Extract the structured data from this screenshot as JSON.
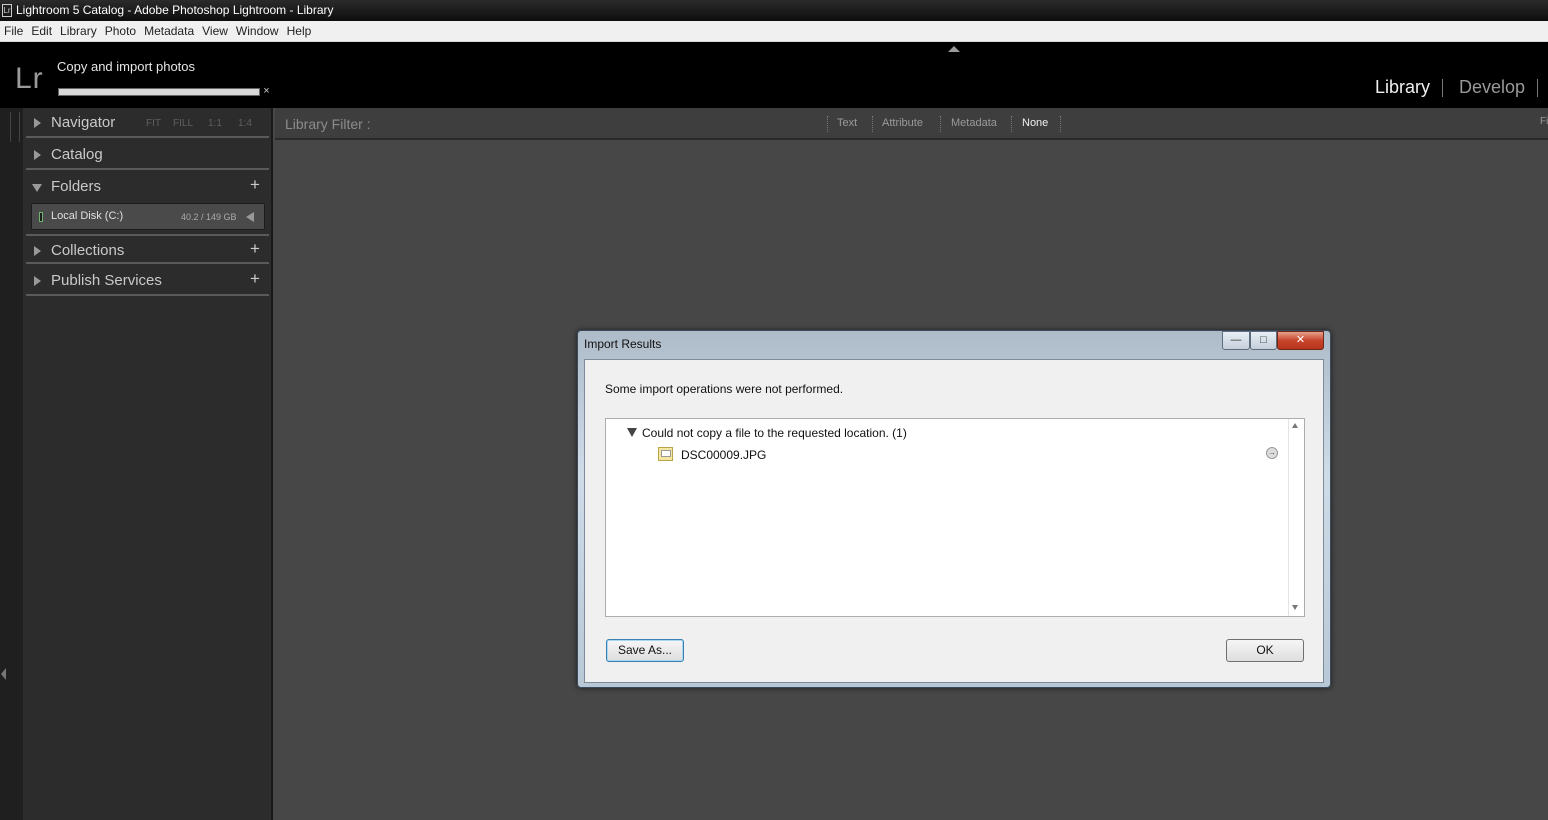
{
  "window": {
    "app_icon": "Lr",
    "title": "Lightroom 5 Catalog - Adobe Photoshop Lightroom - Library"
  },
  "menu": [
    "File",
    "Edit",
    "Library",
    "Photo",
    "Metadata",
    "View",
    "Window",
    "Help"
  ],
  "identity": {
    "logo": "Lr",
    "progress_label": "Copy and import photos",
    "progress_fraction": 1.0,
    "progress_close": "×",
    "modules": {
      "library": "Library",
      "develop": "Develop"
    },
    "active_module": "Library"
  },
  "left_panel": {
    "navigator": {
      "label": "Navigator",
      "zoom_options": [
        "FIT",
        "FILL",
        "1:1",
        "1:4"
      ]
    },
    "catalog": {
      "label": "Catalog"
    },
    "folders": {
      "label": "Folders",
      "plus": "+",
      "volume": {
        "name": "Local Disk (C:)",
        "size": "40.2 / 149 GB"
      }
    },
    "collections": {
      "label": "Collections",
      "plus": "+"
    },
    "publish_services": {
      "label": "Publish Services",
      "plus": "+"
    }
  },
  "filter_bar": {
    "label": "Library Filter :",
    "options": {
      "text": "Text",
      "attribute": "Attribute",
      "metadata": "Metadata",
      "none": "None"
    },
    "selected": "None",
    "right_edge": "Fi"
  },
  "dialog": {
    "title": "Import Results",
    "window_buttons": {
      "minimize": "—",
      "maximize": "□",
      "close": "✕"
    },
    "message": "Some import operations were not performed.",
    "group": {
      "label": "Could not copy a file to the requested location. (1)"
    },
    "files": [
      {
        "name": "DSC00009.JPG",
        "icon": "image-file-icon"
      }
    ],
    "reveal_icon": "→",
    "buttons": {
      "save_as": "Save As...",
      "ok": "OK"
    }
  }
}
